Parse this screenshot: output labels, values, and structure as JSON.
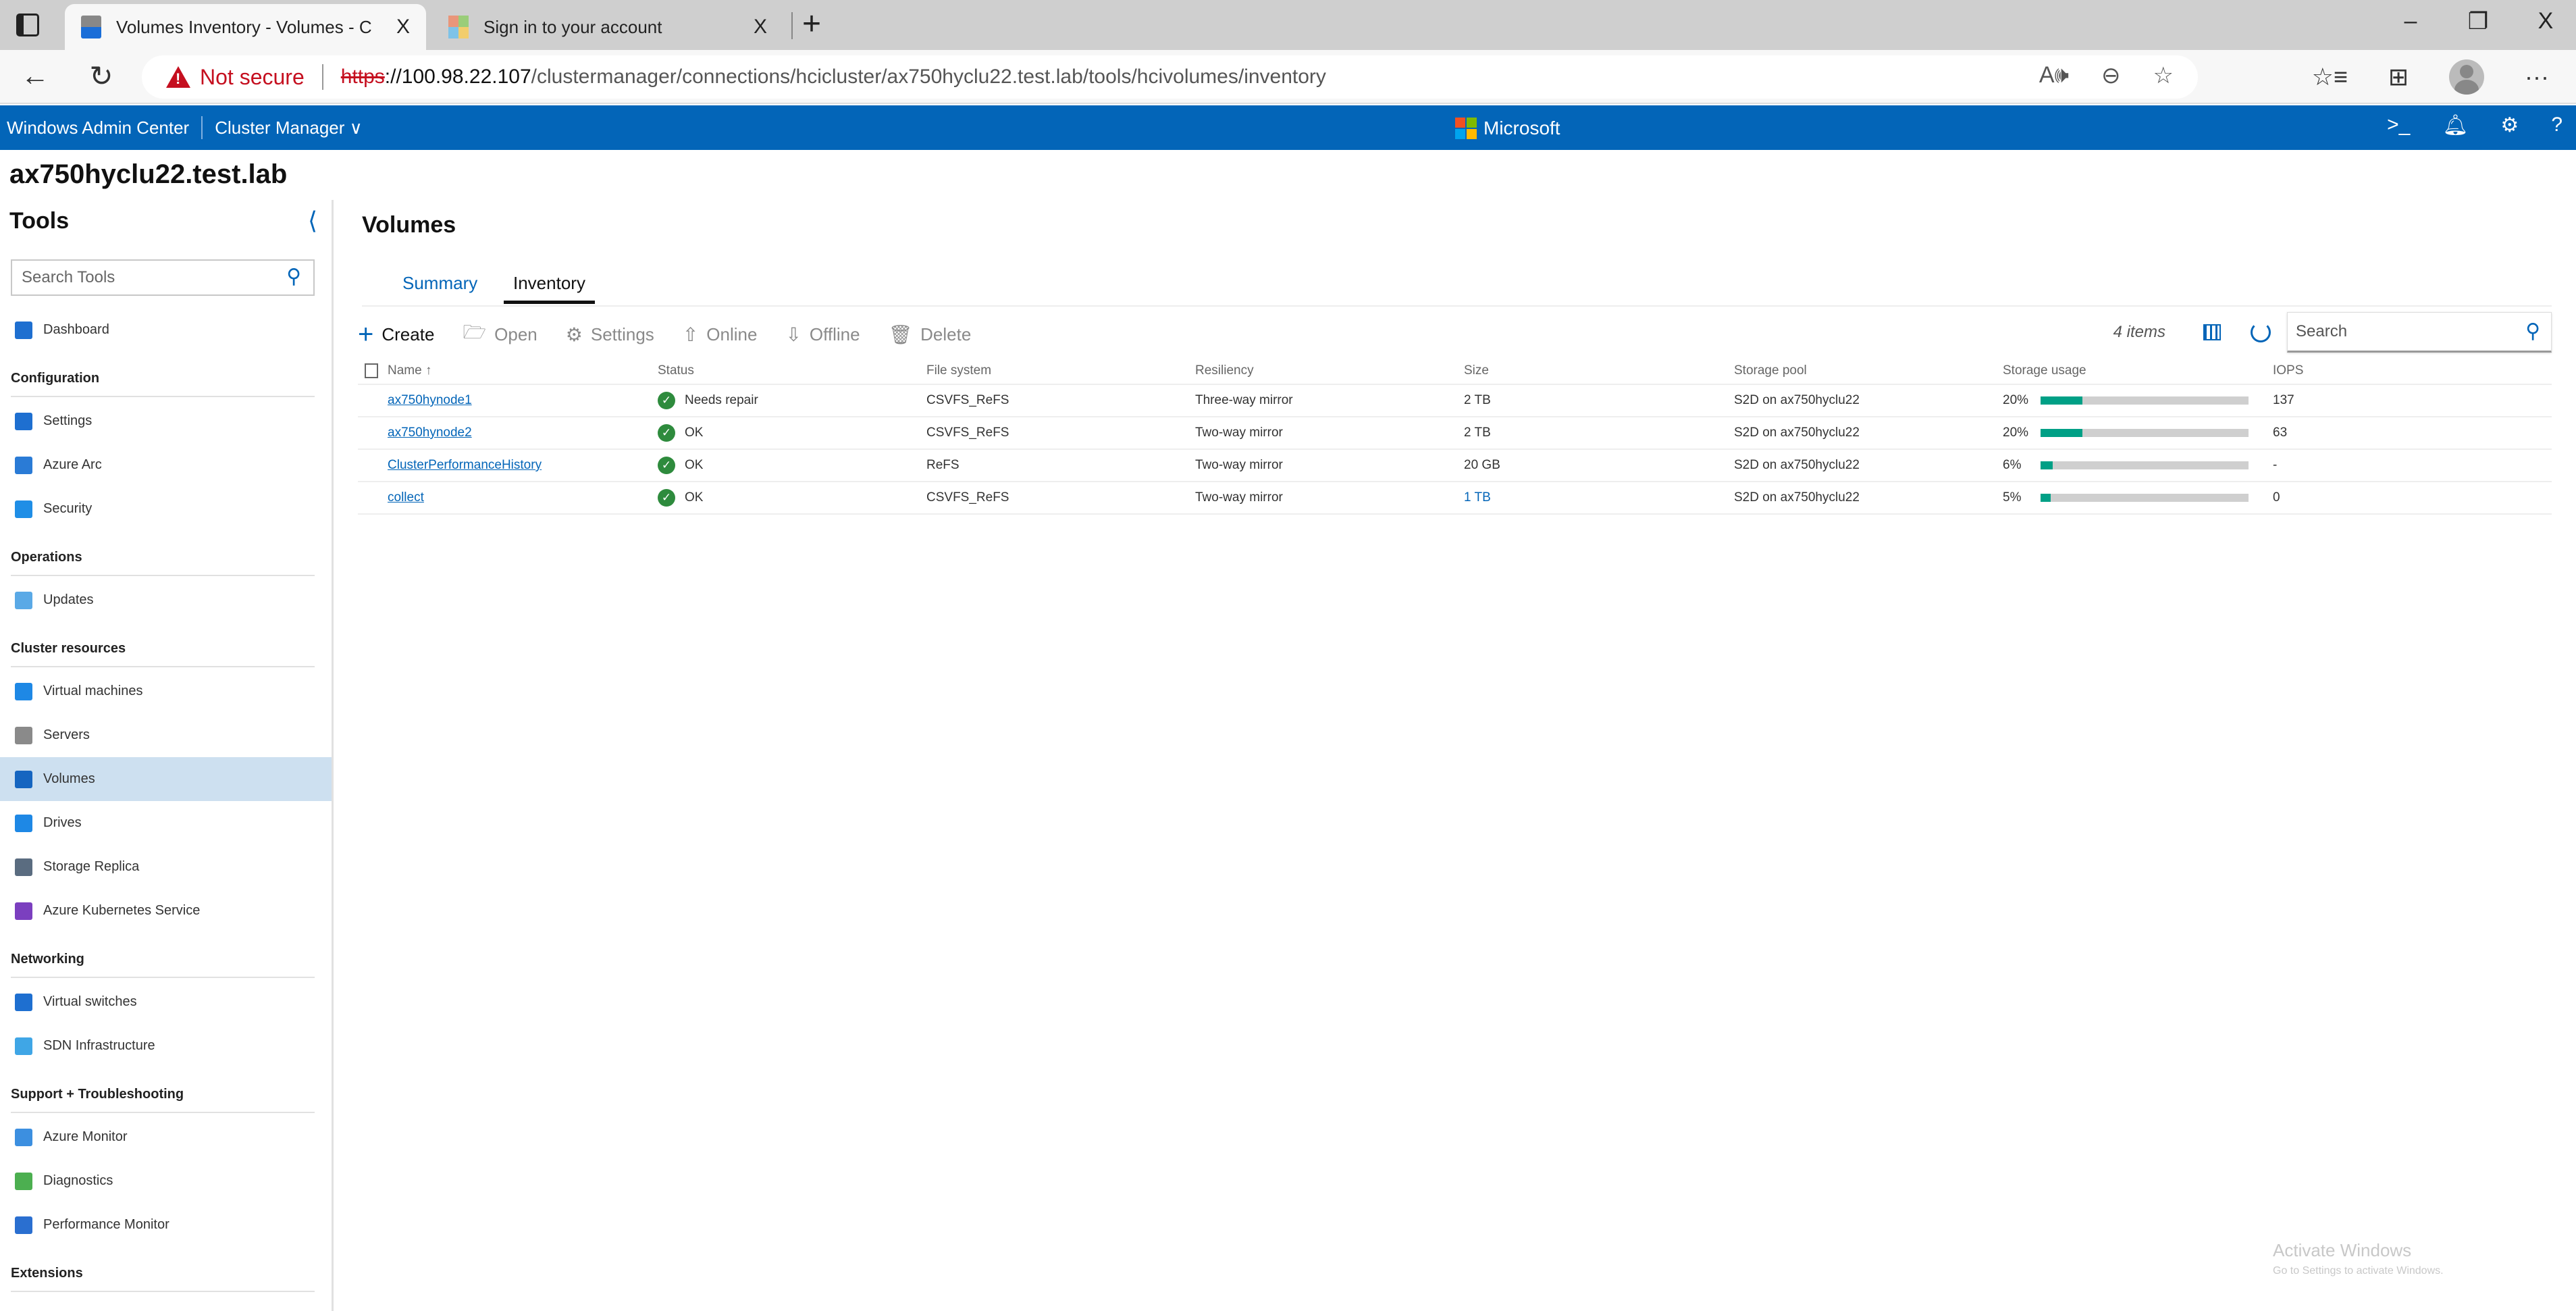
{
  "browser": {
    "tabs": [
      {
        "title": "Volumes Inventory - Volumes - C",
        "active": true,
        "close": "X"
      },
      {
        "title": "Sign in to your account",
        "active": false,
        "close": "X"
      }
    ],
    "new_tab": "+",
    "window_controls": {
      "minimize": "–",
      "restore": "❐",
      "close": "X"
    },
    "security_label": "Not secure",
    "url": {
      "scheme": "https",
      "host": "://100.98.22.107",
      "path": "/clustermanager/connections/hcicluster/ax750hyclu22.test.lab/tools/hcivolumes/inventory"
    },
    "more": "···"
  },
  "header": {
    "app_name": "Windows Admin Center",
    "context": "Cluster Manager",
    "brand": "Microsoft"
  },
  "cluster_name": "ax750hyclu22.test.lab",
  "sidebar": {
    "title": "Tools",
    "search_placeholder": "Search Tools",
    "items": [
      {
        "type": "item",
        "label": "Dashboard",
        "icon": "home-icon",
        "color": "#1e6fd0"
      },
      {
        "type": "section",
        "label": "Configuration"
      },
      {
        "type": "item",
        "label": "Settings",
        "icon": "gear-icon",
        "color": "#1e6fd0"
      },
      {
        "type": "item",
        "label": "Azure Arc",
        "icon": "azure-arc-icon",
        "color": "#2a7bd6"
      },
      {
        "type": "item",
        "label": "Security",
        "icon": "shield-icon",
        "color": "#1f8ee6"
      },
      {
        "type": "section",
        "label": "Operations"
      },
      {
        "type": "item",
        "label": "Updates",
        "icon": "updates-icon",
        "color": "#5aa9e6"
      },
      {
        "type": "section",
        "label": "Cluster resources"
      },
      {
        "type": "item",
        "label": "Virtual machines",
        "icon": "monitor-icon",
        "color": "#1e88e5"
      },
      {
        "type": "item",
        "label": "Servers",
        "icon": "server-icon",
        "color": "#8a8a8a"
      },
      {
        "type": "item",
        "label": "Volumes",
        "icon": "volumes-icon",
        "color": "#1565c0",
        "selected": true
      },
      {
        "type": "item",
        "label": "Drives",
        "icon": "drive-icon",
        "color": "#1e88e5"
      },
      {
        "type": "item",
        "label": "Storage Replica",
        "icon": "storage-replica-icon",
        "color": "#5a6c80"
      },
      {
        "type": "item",
        "label": "Azure Kubernetes Service",
        "icon": "kubernetes-icon",
        "color": "#7b3fbf"
      },
      {
        "type": "section",
        "label": "Networking"
      },
      {
        "type": "item",
        "label": "Virtual switches",
        "icon": "switch-icon",
        "color": "#1e6fd0"
      },
      {
        "type": "item",
        "label": "SDN Infrastructure",
        "icon": "sdn-icon",
        "color": "#3fa6e6"
      },
      {
        "type": "section",
        "label": "Support + Troubleshooting"
      },
      {
        "type": "item",
        "label": "Azure Monitor",
        "icon": "gauge-icon",
        "color": "#3c8fe0"
      },
      {
        "type": "item",
        "label": "Diagnostics",
        "icon": "diagnostics-icon",
        "color": "#4caf50"
      },
      {
        "type": "item",
        "label": "Performance Monitor",
        "icon": "chart-icon",
        "color": "#2a6fd0"
      },
      {
        "type": "section",
        "label": "Extensions"
      }
    ]
  },
  "main": {
    "title": "Volumes",
    "tabs": [
      {
        "label": "Summary",
        "active": false
      },
      {
        "label": "Inventory",
        "active": true
      }
    ],
    "toolbar": {
      "create": "Create",
      "open": "Open",
      "settings": "Settings",
      "online": "Online",
      "offline": "Offline",
      "delete": "Delete",
      "items_count": "4 items",
      "search_placeholder": "Search"
    },
    "columns": [
      "Name ↑",
      "Status",
      "File system",
      "Resiliency",
      "Size",
      "Storage pool",
      "Storage usage",
      "IOPS"
    ],
    "rows": [
      {
        "name": "ax750hynode1",
        "status": "Needs repair",
        "file_system": "CSVFS_ReFS",
        "resiliency": "Three-way mirror",
        "size": "2 TB",
        "pool": "S2D on ax750hyclu22",
        "usage_label": "20%",
        "usage": 0.2,
        "iops": "137"
      },
      {
        "name": "ax750hynode2",
        "status": "OK",
        "file_system": "CSVFS_ReFS",
        "resiliency": "Two-way mirror",
        "size": "2 TB",
        "pool": "S2D on ax750hyclu22",
        "usage_label": "20%",
        "usage": 0.2,
        "iops": "63"
      },
      {
        "name": "ClusterPerformanceHistory",
        "status": "OK",
        "file_system": "ReFS",
        "resiliency": "Two-way mirror",
        "size": "20 GB",
        "pool": "S2D on ax750hyclu22",
        "usage_label": "6%",
        "usage": 0.06,
        "iops": "-"
      },
      {
        "name": "collect",
        "status": "OK",
        "file_system": "CSVFS_ReFS",
        "resiliency": "Two-way mirror",
        "size": "1 TB",
        "pool": "S2D on ax750hyclu22",
        "usage_label": "5%",
        "usage": 0.05,
        "iops": "0"
      }
    ]
  },
  "watermark": {
    "line1": "Activate Windows",
    "line2": "Go to Settings to activate Windows."
  },
  "colors": {
    "accent": "#0365b8",
    "usage_fill": "#00a086",
    "ok": "#2e8b3d",
    "danger": "#c50f1f"
  }
}
